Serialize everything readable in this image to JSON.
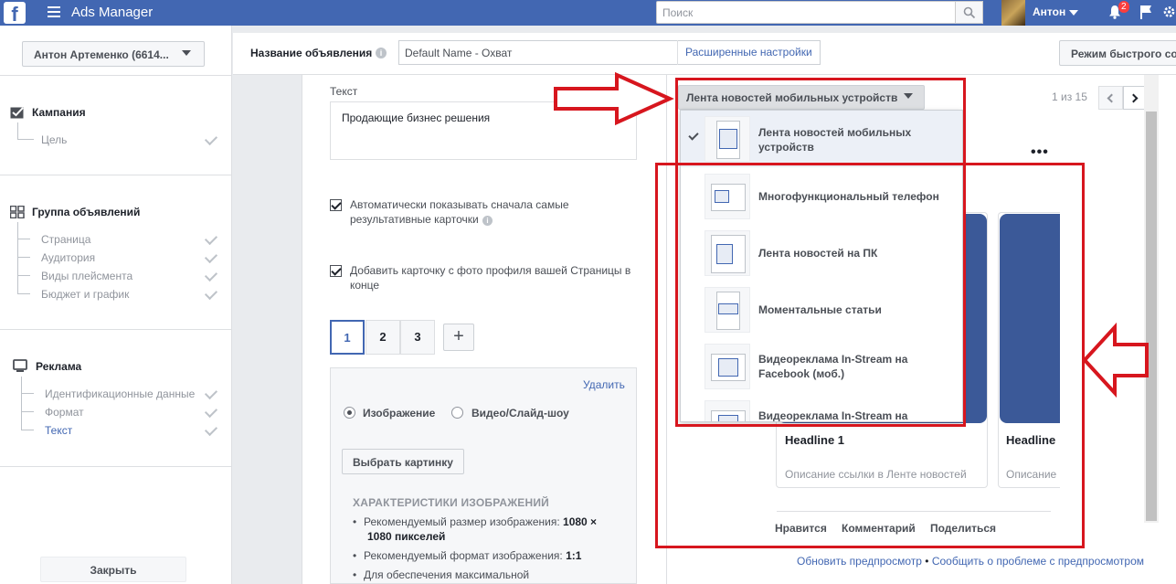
{
  "topbar": {
    "logo": "f",
    "app_title": "Ads Manager",
    "search_placeholder": "Поиск",
    "user_name": "Антон",
    "notification_count": "2"
  },
  "sidebar": {
    "account": "Антон Артеменко (6614...",
    "campaign": {
      "title": "Кампания",
      "items": [
        "Цель"
      ]
    },
    "adset": {
      "title": "Группа объявлений",
      "items": [
        "Страница",
        "Аудитория",
        "Виды плейсмента",
        "Бюджет и график"
      ]
    },
    "ad": {
      "title": "Реклама",
      "items": [
        "Идентификационные данные",
        "Формат",
        "Текст"
      ]
    },
    "close_label": "Закрыть"
  },
  "namebar": {
    "label": "Название объявления",
    "value": "Default Name - Охват",
    "advanced_link": "Расширенные настройки",
    "quick_mode": "Режим быстрого со"
  },
  "form": {
    "text_label": "Текст",
    "text_value": "Продающие бизнес решения",
    "auto_show_line1": "Автоматически показывать сначала самые",
    "auto_show_line2": "результативные карточки",
    "add_card_line1": "Добавить карточку с фото профиля вашей Страницы в",
    "add_card_line2": "конце",
    "card_tabs": [
      "1",
      "2",
      "3"
    ],
    "add_card_icon": "+",
    "delete_label": "Удалить",
    "media_image": "Изображение",
    "media_video": "Видео/Слайд-шоу",
    "choose_image": "Выбрать картинку",
    "specs_title": "ХАРАКТЕРИСТИКИ ИЗОБРАЖЕНИЙ",
    "spec1_text": "Рекомендуемый размер изображения: ",
    "spec1_bold_a": "1080 ×",
    "spec1_bold_b": "1080 пикселей",
    "spec2_text": "Рекомендуемый формат изображения: ",
    "spec2_bold": "1:1",
    "spec3_text": "Для обеспечения максимальной"
  },
  "preview": {
    "placement_selected": "Лента новостей мобильных устройств",
    "page_counter": "1 из 15",
    "more_icon": "•••",
    "dropdown_items": [
      {
        "line1": "Лента новостей мобильных",
        "line2": "устройств"
      },
      {
        "line1": "Многофункциональный телефон",
        "line2": ""
      },
      {
        "line1": "Лента новостей на ПК",
        "line2": ""
      },
      {
        "line1": "Моментальные статьи",
        "line2": ""
      },
      {
        "line1": "Видеореклама In-Stream на",
        "line2": "Facebook (моб.)"
      },
      {
        "line1": "Видеореклама In-Stream на",
        "line2": ""
      }
    ],
    "card1_headline": "Headline 1",
    "card1_desc": "Описание ссылки в Ленте новостей",
    "card2_headline": "Headline",
    "card2_desc": "Описание",
    "actions": [
      "Нравится",
      "Комментарий",
      "Поделиться"
    ],
    "footer_refresh": "Обновить предпросмотр",
    "footer_sep": " • ",
    "footer_report": "Сообщить о проблеме с предпросмотром"
  },
  "colors": {
    "brand": "#4267b2",
    "annotation_red": "#d7161e",
    "card_image": "#3b5998"
  }
}
